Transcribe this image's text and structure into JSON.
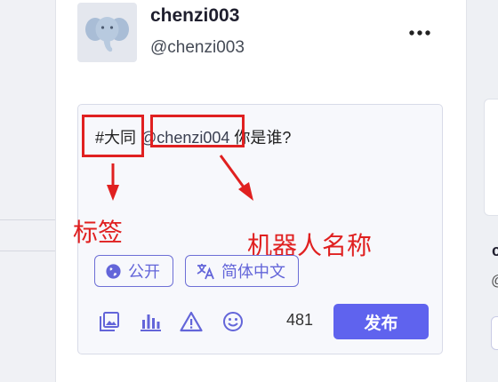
{
  "profile": {
    "display_name": "chenzi003",
    "handle": "@chenzi003"
  },
  "composer": {
    "hashtag": "#大同",
    "mention": "@chenzi004",
    "text_rest": " 你是谁?",
    "visibility_label": "公开",
    "language_label": "简体中文",
    "char_count": "481",
    "publish_label": "发布"
  },
  "annotations": {
    "tag_label": "标签",
    "bot_name_label": "机器人名称",
    "color": "#e02020"
  },
  "right_panel": {
    "letter": "c",
    "at": "@"
  },
  "icons": {
    "more": "more-icon",
    "globe": "globe-icon",
    "translate": "translate-icon",
    "image": "image-icon",
    "poll": "poll-icon",
    "warning": "warning-icon",
    "emoji": "emoji-icon"
  },
  "colors": {
    "accent": "#5f63ee",
    "chip": "#6365d9",
    "annotation": "#e02020"
  }
}
